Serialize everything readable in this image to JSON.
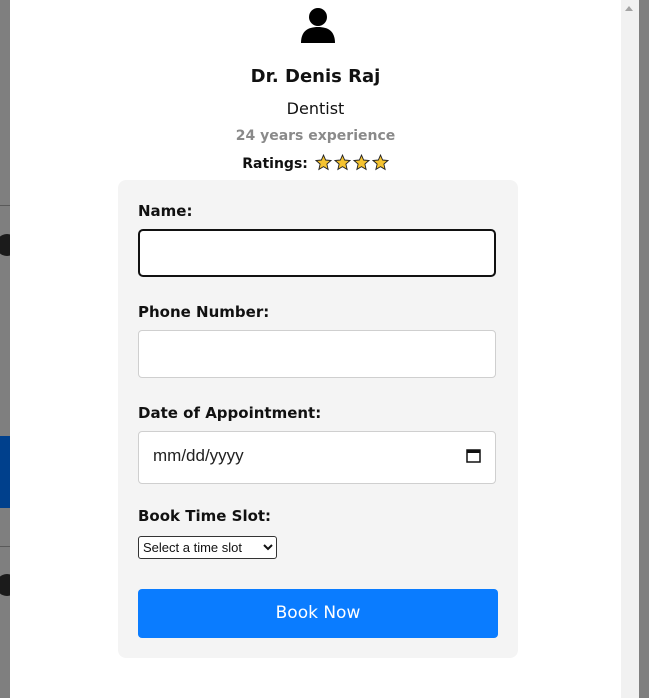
{
  "doctor": {
    "name": "Dr. Denis Raj",
    "specialty": "Dentist",
    "experience": "24 years experience",
    "ratings_label": "Ratings:",
    "stars": 4
  },
  "form": {
    "name_label": "Name:",
    "name_value": "",
    "phone_label": "Phone Number:",
    "phone_value": "",
    "date_label": "Date of Appointment:",
    "date_placeholder": "mm/dd/yyyy",
    "slot_label": "Book Time Slot:",
    "slot_selected": "Select a time slot",
    "submit_label": "Book Now"
  },
  "colors": {
    "accent": "#0a7cff",
    "star": "#f5c330",
    "experience_text": "#8a8a8a"
  },
  "icons": [
    "person-icon",
    "star-icon",
    "calendar-icon",
    "chevron-down-icon",
    "scroll-up-arrow-icon"
  ]
}
